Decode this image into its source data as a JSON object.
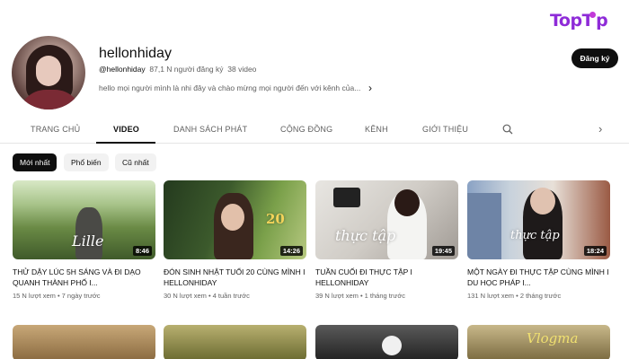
{
  "brand": {
    "text": "TopT",
    "text_end": "p"
  },
  "channel": {
    "name": "hellonhiday",
    "handle": "@hellonhiday",
    "subscribers": "87,1 N người đăng ký",
    "video_count": "38 video",
    "description": "hello mọi người mình là nhi đây và chào mừng mọi người đến với kênh của...",
    "subscribe_label": "Đăng ký"
  },
  "tabs": [
    {
      "label": "TRANG CHỦ"
    },
    {
      "label": "VIDEO"
    },
    {
      "label": "DANH SÁCH PHÁT"
    },
    {
      "label": "CỘNG ĐỒNG"
    },
    {
      "label": "KÊNH"
    },
    {
      "label": "GIỚI THIỆU"
    }
  ],
  "chips": [
    {
      "label": "Mới nhất"
    },
    {
      "label": "Phổ biến"
    },
    {
      "label": "Cũ nhất"
    }
  ],
  "videos": [
    {
      "title": "THỬ DẬY LÚC 5H SÁNG VÀ ĐI DẠO QUANH THÀNH PHỐ I...",
      "views": "15 N lượt xem",
      "age": "7 ngày trước",
      "duration": "8:46",
      "overlay": "Lille"
    },
    {
      "title": "ĐÓN SINH NHẬT TUỔI 20 CÙNG MÌNH I HELLONHIDAY",
      "views": "30 N lượt xem",
      "age": "4 tuần trước",
      "duration": "14:26",
      "overlay": "20"
    },
    {
      "title": "TUẦN CUỐI ĐI THỰC TẬP I HELLONHIDAY",
      "views": "39 N lượt xem",
      "age": "1 tháng trước",
      "duration": "19:45",
      "overlay": "thực tập"
    },
    {
      "title": "MỘT NGÀY ĐI THỰC TẬP CÙNG MÌNH I DU HỌC PHÁP I...",
      "views": "131 N lượt xem",
      "age": "2 tháng trước",
      "duration": "18:24",
      "overlay": "thực tập"
    }
  ],
  "row2_overlay": "Vlogma",
  "colors": {
    "accent": "#0f0f0f",
    "brand": "#8e2bd8",
    "muted": "#606060"
  }
}
